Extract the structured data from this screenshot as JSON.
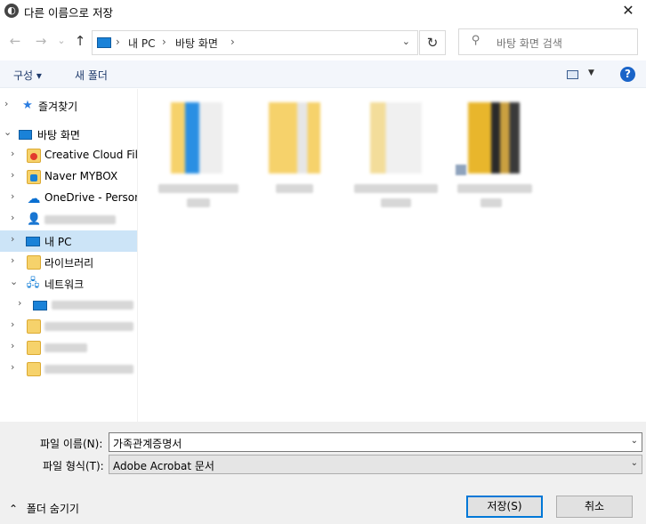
{
  "window": {
    "title": "다른 이름으로 저장",
    "close_symbol": "✕"
  },
  "nav": {
    "back": "←",
    "forward": "→",
    "recent": "⌄",
    "up": "↑",
    "address": {
      "items": [
        "내 PC",
        "바탕 화면"
      ],
      "separator": "›"
    },
    "refresh": "↻",
    "search_placeholder": "바탕 화면 검색"
  },
  "toolbar": {
    "organize": "구성 ▾",
    "new_folder": "새 폴더",
    "help": "?"
  },
  "sidebar": {
    "items": [
      {
        "label": "즐겨찾기",
        "icon": "star-icon"
      },
      {
        "label": "바탕 화면",
        "icon": "desktop-icon"
      },
      {
        "label": "Creative Cloud Files",
        "icon": "creative-cloud-icon"
      },
      {
        "label": "Naver MYBOX",
        "icon": "naver-mybox-icon"
      },
      {
        "label": "OneDrive - Personal",
        "icon": "onedrive-icon"
      },
      {
        "label": "",
        "icon": "user-icon"
      },
      {
        "label": "내 PC",
        "icon": "pc-icon"
      },
      {
        "label": "라이브러리",
        "icon": "library-icon"
      },
      {
        "label": "네트워크",
        "icon": "network-icon"
      },
      {
        "label": "",
        "icon": "computer-icon"
      },
      {
        "label": "",
        "icon": "folder-icon"
      },
      {
        "label": "",
        "icon": "folder-icon"
      },
      {
        "label": "",
        "icon": "folder-icon"
      }
    ]
  },
  "files": [
    {
      "label": "",
      "icon": "folder-with-document-icon"
    },
    {
      "label": "",
      "icon": "folder-icon"
    },
    {
      "label": "",
      "icon": "folder-icon"
    },
    {
      "label": "",
      "icon": "shortcut-file-icon"
    }
  ],
  "form": {
    "filename_label": "파일 이름(N):",
    "filename_value": "가족관계증명서",
    "filetype_label": "파일 형식(T):",
    "filetype_value": "Adobe Acrobat 문서"
  },
  "footer": {
    "hide_folders": "폴더 숨기기",
    "save": "저장(S)",
    "cancel": "취소"
  },
  "colors": {
    "accent": "#0078d7",
    "selected": "#cce4f7",
    "toolbar_bg": "#f3f6fb"
  }
}
